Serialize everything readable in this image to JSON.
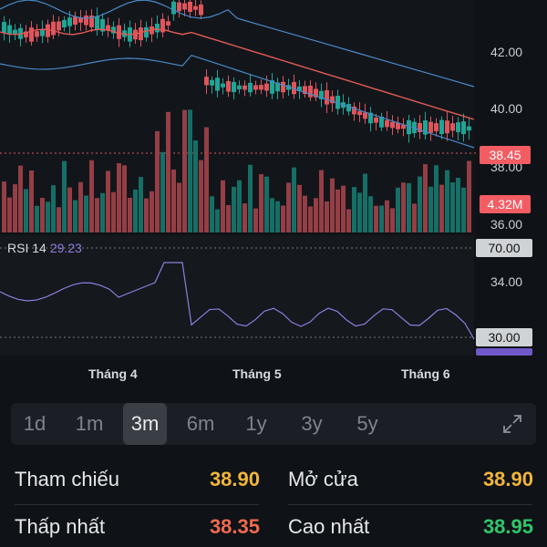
{
  "price_axis": [
    "42.00",
    "40.00",
    "38.00",
    "36.00"
  ],
  "rsi_axis": [
    "34.00"
  ],
  "months": [
    "Tháng 4",
    "Tháng 5",
    "Tháng 6"
  ],
  "price_tag": "38.45",
  "volume_tag": "4.32M",
  "rsi": {
    "label": "RSI 14",
    "value": "29.23",
    "upper_tag": "70.00",
    "lower_tag": "30.00"
  },
  "colors": {
    "up": "#1fa596",
    "down": "#e0545c",
    "ma_red": "#e25a55",
    "band_blue": "#4a88c7",
    "rsi_line": "#8e7ee0"
  },
  "ranges": [
    {
      "label": "1d",
      "active": false
    },
    {
      "label": "1m",
      "active": false
    },
    {
      "label": "3m",
      "active": true
    },
    {
      "label": "6m",
      "active": false
    },
    {
      "label": "1y",
      "active": false
    },
    {
      "label": "3y",
      "active": false
    },
    {
      "label": "5y",
      "active": false
    }
  ],
  "stats": {
    "reference": {
      "label": "Tham chiếu",
      "value": "38.90",
      "color": "#f0b53a"
    },
    "open": {
      "label": "Mở cửa",
      "value": "38.90",
      "color": "#f0b53a"
    },
    "low": {
      "label": "Thấp nhất",
      "value": "38.35",
      "color": "#f06a4f"
    },
    "high": {
      "label": "Cao nhất",
      "value": "38.95",
      "color": "#2ec76a"
    }
  }
}
